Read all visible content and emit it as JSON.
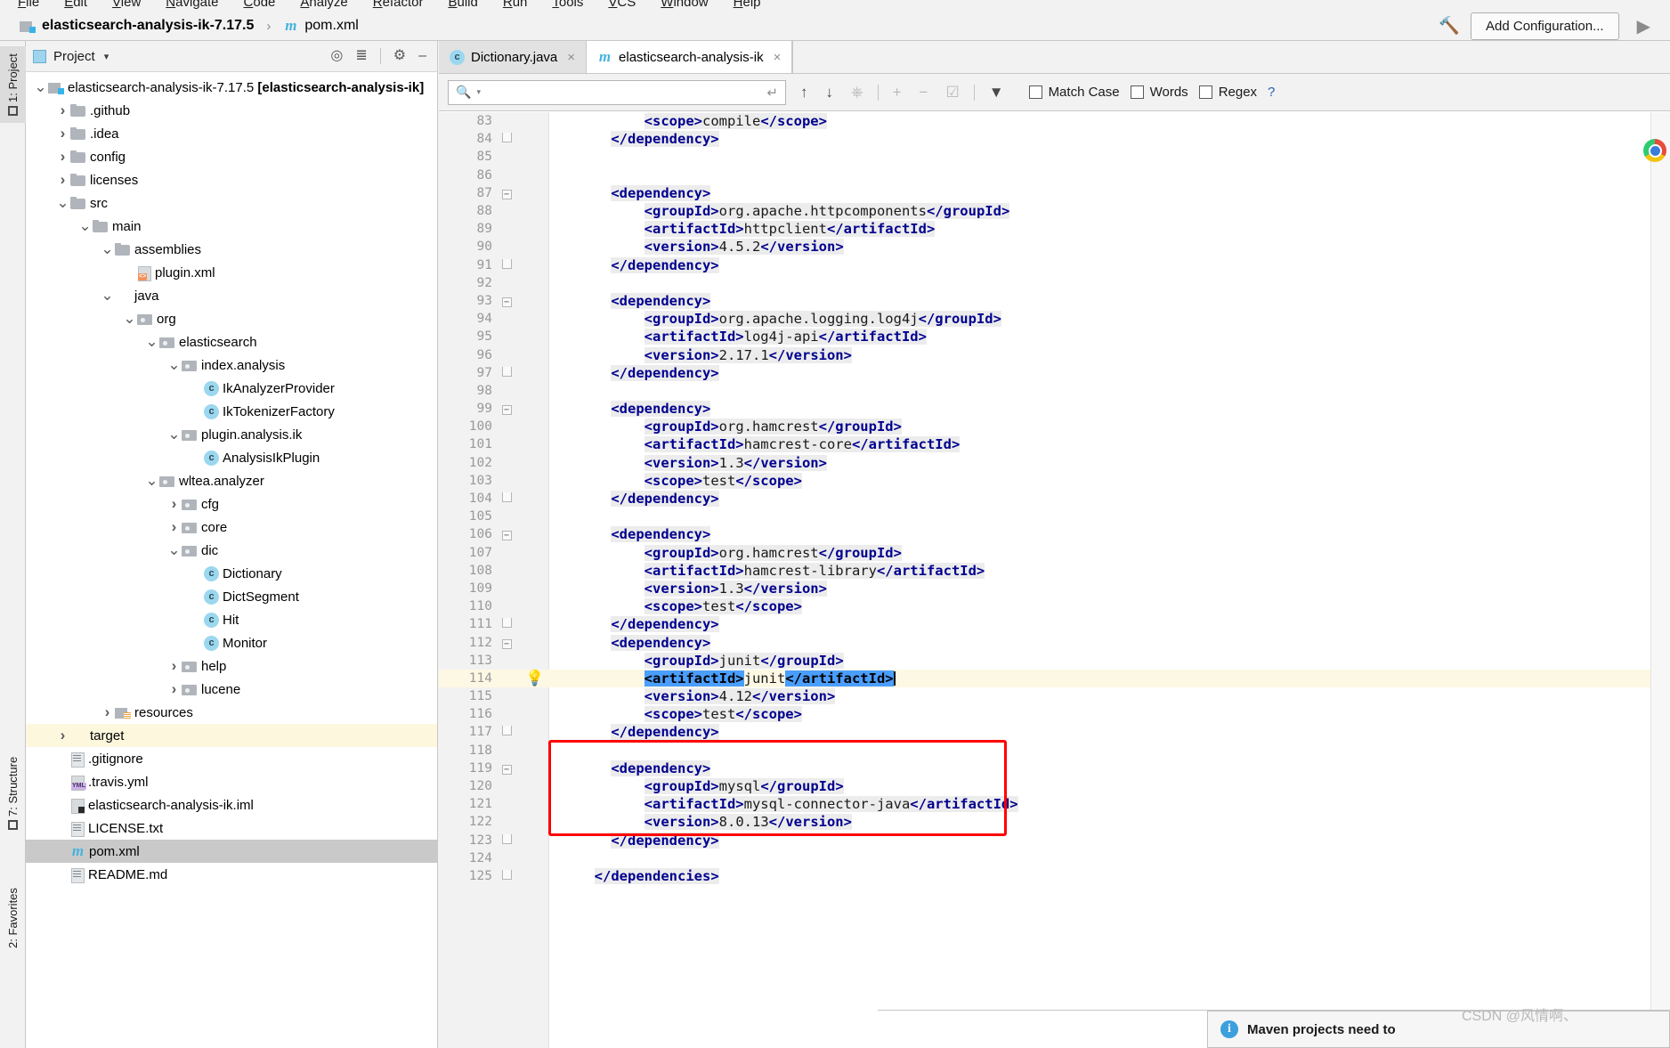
{
  "menu": {
    "items": [
      "File",
      "Edit",
      "View",
      "Navigate",
      "Code",
      "Analyze",
      "Refactor",
      "Build",
      "Run",
      "Tools",
      "VCS",
      "Window",
      "Help"
    ]
  },
  "navbar": {
    "project_name": "elasticsearch-analysis-ik-7.17.5",
    "separator": "›",
    "file_name": "pom.xml",
    "maven_glyph": "m",
    "add_configuration_label": "Add Configuration...",
    "run_icon": "run-play-icon",
    "hammer_icon": "build-hammer-icon"
  },
  "left_tool_strip": {
    "tabs": [
      "1: Project",
      "7: Structure",
      "2: Favorites"
    ]
  },
  "project_panel": {
    "title": "Project",
    "caret": "▾",
    "toolbar_icons": [
      "locate-target-icon",
      "collapse-all-icon",
      "gear-icon",
      "hide-icon"
    ],
    "tree": [
      {
        "depth": 0,
        "arrow": "down",
        "icon": "srcmark",
        "label": "elasticsearch-analysis-ik-7.17.5 ",
        "bold": "[elasticsearch-analysis-ik]",
        "state": "normal"
      },
      {
        "depth": 1,
        "arrow": "right",
        "icon": "folder",
        "label": ".github",
        "state": "normal"
      },
      {
        "depth": 1,
        "arrow": "right",
        "icon": "folder",
        "label": ".idea",
        "state": "normal"
      },
      {
        "depth": 1,
        "arrow": "right",
        "icon": "folder",
        "label": "config",
        "state": "normal"
      },
      {
        "depth": 1,
        "arrow": "right",
        "icon": "folder",
        "label": "licenses",
        "state": "normal"
      },
      {
        "depth": 1,
        "arrow": "down",
        "icon": "folder",
        "label": "src",
        "state": "normal"
      },
      {
        "depth": 2,
        "arrow": "down",
        "icon": "folder",
        "label": "main",
        "state": "normal"
      },
      {
        "depth": 3,
        "arrow": "down",
        "icon": "folder",
        "label": "assemblies",
        "state": "normal"
      },
      {
        "depth": 4,
        "arrow": "none",
        "icon": "xml",
        "label": "plugin.xml",
        "state": "normal"
      },
      {
        "depth": 3,
        "arrow": "down",
        "icon": "folder-blue",
        "label": "java",
        "state": "normal"
      },
      {
        "depth": 4,
        "arrow": "down",
        "icon": "pkg",
        "label": "org",
        "state": "normal"
      },
      {
        "depth": 5,
        "arrow": "down",
        "icon": "pkg",
        "label": "elasticsearch",
        "state": "normal"
      },
      {
        "depth": 6,
        "arrow": "down",
        "icon": "pkg",
        "label": "index.analysis",
        "state": "normal"
      },
      {
        "depth": 7,
        "arrow": "none",
        "icon": "class",
        "label": "IkAnalyzerProvider",
        "state": "normal"
      },
      {
        "depth": 7,
        "arrow": "none",
        "icon": "class",
        "label": "IkTokenizerFactory",
        "state": "normal"
      },
      {
        "depth": 6,
        "arrow": "down",
        "icon": "pkg",
        "label": "plugin.analysis.ik",
        "state": "normal"
      },
      {
        "depth": 7,
        "arrow": "none",
        "icon": "class",
        "label": "AnalysisIkPlugin",
        "state": "normal"
      },
      {
        "depth": 5,
        "arrow": "down",
        "icon": "pkg",
        "label": "wltea.analyzer",
        "state": "normal"
      },
      {
        "depth": 6,
        "arrow": "right",
        "icon": "pkg",
        "label": "cfg",
        "state": "normal"
      },
      {
        "depth": 6,
        "arrow": "right",
        "icon": "pkg",
        "label": "core",
        "state": "normal"
      },
      {
        "depth": 6,
        "arrow": "down",
        "icon": "pkg",
        "label": "dic",
        "state": "normal"
      },
      {
        "depth": 7,
        "arrow": "none",
        "icon": "class",
        "label": "Dictionary",
        "state": "normal"
      },
      {
        "depth": 7,
        "arrow": "none",
        "icon": "class",
        "label": "DictSegment",
        "state": "normal"
      },
      {
        "depth": 7,
        "arrow": "none",
        "icon": "class",
        "label": "Hit",
        "state": "normal"
      },
      {
        "depth": 7,
        "arrow": "none",
        "icon": "class",
        "label": "Monitor",
        "state": "normal"
      },
      {
        "depth": 6,
        "arrow": "right",
        "icon": "pkg",
        "label": "help",
        "state": "normal"
      },
      {
        "depth": 6,
        "arrow": "right",
        "icon": "pkg",
        "label": "lucene",
        "state": "normal"
      },
      {
        "depth": 3,
        "arrow": "right",
        "icon": "resmark",
        "label": "resources",
        "state": "normal"
      },
      {
        "depth": 1,
        "arrow": "right",
        "icon": "folder-orange",
        "label": "target",
        "state": "highlight"
      },
      {
        "depth": 1,
        "arrow": "none",
        "icon": "txt",
        "label": ".gitignore",
        "state": "normal"
      },
      {
        "depth": 1,
        "arrow": "none",
        "icon": "yml",
        "label": ".travis.yml",
        "state": "normal"
      },
      {
        "depth": 1,
        "arrow": "none",
        "icon": "iml",
        "label": "elasticsearch-analysis-ik.iml",
        "state": "normal"
      },
      {
        "depth": 1,
        "arrow": "none",
        "icon": "txt",
        "label": "LICENSE.txt",
        "state": "normal"
      },
      {
        "depth": 1,
        "arrow": "none",
        "icon": "maven",
        "label": "pom.xml",
        "state": "selected"
      },
      {
        "depth": 1,
        "arrow": "none",
        "icon": "txt",
        "label": "README.md",
        "state": "normal"
      }
    ]
  },
  "editor": {
    "tabs": [
      {
        "label": "Dictionary.java",
        "icon": "class",
        "active": false,
        "close": "×"
      },
      {
        "label": "elasticsearch-analysis-ik",
        "icon": "maven",
        "active": true,
        "close": "×"
      }
    ],
    "find_bar": {
      "search_value": "",
      "search_placeholder": "",
      "search_icon": "search-magnifier-icon",
      "dropdown_caret": "▾",
      "return_icon": "↵",
      "buttons": [
        "find-prev-up-icon",
        "find-next-down-icon",
        "select-all-occurrences-icon",
        "add-line-icon",
        "remove-line-icon",
        "check-lines-icon",
        "filter-icon"
      ],
      "match_case_label": "Match Case",
      "words_label": "Words",
      "regex_label": "Regex",
      "help_label": "?"
    },
    "first_line_number": 83,
    "current_line": 114,
    "lines": [
      {
        "n": 83,
        "fold": "",
        "indent": 8,
        "tokens": [
          {
            "t": "<scope>",
            "k": "tg",
            "hl": true
          },
          {
            "t": "compile",
            "k": "txt",
            "hl": true
          },
          {
            "t": "</scope>",
            "k": "tg",
            "hl": true
          }
        ]
      },
      {
        "n": 84,
        "fold": "cap",
        "indent": 4,
        "tokens": [
          {
            "t": "</dependency>",
            "k": "tg",
            "hl": true
          }
        ]
      },
      {
        "n": 85,
        "fold": "",
        "indent": 0,
        "tokens": []
      },
      {
        "n": 86,
        "fold": "",
        "indent": 0,
        "tokens": []
      },
      {
        "n": 87,
        "fold": "minus",
        "indent": 4,
        "tokens": [
          {
            "t": "<dependency>",
            "k": "tg",
            "hl": true
          }
        ]
      },
      {
        "n": 88,
        "fold": "",
        "indent": 8,
        "tokens": [
          {
            "t": "<groupId>",
            "k": "tg",
            "hl": true
          },
          {
            "t": "org.apache.httpcomponents",
            "k": "txt",
            "hl": true
          },
          {
            "t": "</groupId>",
            "k": "tg",
            "hl": true
          }
        ]
      },
      {
        "n": 89,
        "fold": "",
        "indent": 8,
        "tokens": [
          {
            "t": "<artifactId>",
            "k": "tg",
            "hl": true
          },
          {
            "t": "httpclient",
            "k": "txt",
            "hl": true
          },
          {
            "t": "</artifactId>",
            "k": "tg",
            "hl": true
          }
        ]
      },
      {
        "n": 90,
        "fold": "",
        "indent": 8,
        "tokens": [
          {
            "t": "<version>",
            "k": "tg",
            "hl": true
          },
          {
            "t": "4.5.2",
            "k": "txt",
            "hl": true
          },
          {
            "t": "</version>",
            "k": "tg",
            "hl": true
          }
        ]
      },
      {
        "n": 91,
        "fold": "cap",
        "indent": 4,
        "tokens": [
          {
            "t": "</dependency>",
            "k": "tg",
            "hl": true
          }
        ]
      },
      {
        "n": 92,
        "fold": "",
        "indent": 0,
        "tokens": []
      },
      {
        "n": 93,
        "fold": "minus",
        "indent": 4,
        "tokens": [
          {
            "t": "<dependency>",
            "k": "tg",
            "hl": true
          }
        ]
      },
      {
        "n": 94,
        "fold": "",
        "indent": 8,
        "tokens": [
          {
            "t": "<groupId>",
            "k": "tg",
            "hl": true
          },
          {
            "t": "org.apache.logging.log4j",
            "k": "txt",
            "hl": true
          },
          {
            "t": "</groupId>",
            "k": "tg",
            "hl": true
          }
        ]
      },
      {
        "n": 95,
        "fold": "",
        "indent": 8,
        "tokens": [
          {
            "t": "<artifactId>",
            "k": "tg",
            "hl": true
          },
          {
            "t": "log4j-api",
            "k": "txt",
            "hl": true
          },
          {
            "t": "</artifactId>",
            "k": "tg",
            "hl": true
          }
        ]
      },
      {
        "n": 96,
        "fold": "",
        "indent": 8,
        "tokens": [
          {
            "t": "<version>",
            "k": "tg",
            "hl": true
          },
          {
            "t": "2.17.1",
            "k": "txt",
            "hl": true
          },
          {
            "t": "</version>",
            "k": "tg",
            "hl": true
          }
        ]
      },
      {
        "n": 97,
        "fold": "cap",
        "indent": 4,
        "tokens": [
          {
            "t": "</dependency>",
            "k": "tg",
            "hl": true
          }
        ]
      },
      {
        "n": 98,
        "fold": "",
        "indent": 0,
        "tokens": []
      },
      {
        "n": 99,
        "fold": "minus",
        "indent": 4,
        "tokens": [
          {
            "t": "<dependency>",
            "k": "tg",
            "hl": true
          }
        ]
      },
      {
        "n": 100,
        "fold": "",
        "indent": 8,
        "tokens": [
          {
            "t": "<groupId>",
            "k": "tg",
            "hl": true
          },
          {
            "t": "org.hamcrest",
            "k": "txt",
            "hl": true
          },
          {
            "t": "</groupId>",
            "k": "tg",
            "hl": true
          }
        ]
      },
      {
        "n": 101,
        "fold": "",
        "indent": 8,
        "tokens": [
          {
            "t": "<artifactId>",
            "k": "tg",
            "hl": true
          },
          {
            "t": "hamcrest-core",
            "k": "txt",
            "hl": true
          },
          {
            "t": "</artifactId>",
            "k": "tg",
            "hl": true
          }
        ]
      },
      {
        "n": 102,
        "fold": "",
        "indent": 8,
        "tokens": [
          {
            "t": "<version>",
            "k": "tg",
            "hl": true
          },
          {
            "t": "1.3",
            "k": "txt",
            "hl": true
          },
          {
            "t": "</version>",
            "k": "tg",
            "hl": true
          }
        ]
      },
      {
        "n": 103,
        "fold": "",
        "indent": 8,
        "tokens": [
          {
            "t": "<scope>",
            "k": "tg",
            "hl": true
          },
          {
            "t": "test",
            "k": "txt",
            "hl": true
          },
          {
            "t": "</scope>",
            "k": "tg",
            "hl": true
          }
        ]
      },
      {
        "n": 104,
        "fold": "cap",
        "indent": 4,
        "tokens": [
          {
            "t": "</dependency>",
            "k": "tg",
            "hl": true
          }
        ]
      },
      {
        "n": 105,
        "fold": "",
        "indent": 0,
        "tokens": []
      },
      {
        "n": 106,
        "fold": "minus",
        "indent": 4,
        "tokens": [
          {
            "t": "<dependency>",
            "k": "tg",
            "hl": true
          }
        ]
      },
      {
        "n": 107,
        "fold": "",
        "indent": 8,
        "tokens": [
          {
            "t": "<groupId>",
            "k": "tg",
            "hl": true
          },
          {
            "t": "org.hamcrest",
            "k": "txt",
            "hl": true
          },
          {
            "t": "</groupId>",
            "k": "tg",
            "hl": true
          }
        ]
      },
      {
        "n": 108,
        "fold": "",
        "indent": 8,
        "tokens": [
          {
            "t": "<artifactId>",
            "k": "tg",
            "hl": true
          },
          {
            "t": "hamcrest-library",
            "k": "txt",
            "hl": true
          },
          {
            "t": "</artifactId>",
            "k": "tg",
            "hl": true
          }
        ]
      },
      {
        "n": 109,
        "fold": "",
        "indent": 8,
        "tokens": [
          {
            "t": "<version>",
            "k": "tg",
            "hl": true
          },
          {
            "t": "1.3",
            "k": "txt",
            "hl": true
          },
          {
            "t": "</version>",
            "k": "tg",
            "hl": true
          }
        ]
      },
      {
        "n": 110,
        "fold": "",
        "indent": 8,
        "tokens": [
          {
            "t": "<scope>",
            "k": "tg",
            "hl": true
          },
          {
            "t": "test",
            "k": "txt",
            "hl": true
          },
          {
            "t": "</scope>",
            "k": "tg",
            "hl": true
          }
        ]
      },
      {
        "n": 111,
        "fold": "cap",
        "indent": 4,
        "tokens": [
          {
            "t": "</dependency>",
            "k": "tg",
            "hl": true
          }
        ]
      },
      {
        "n": 112,
        "fold": "minus",
        "indent": 4,
        "tokens": [
          {
            "t": "<dependency>",
            "k": "tg",
            "hl": true
          }
        ]
      },
      {
        "n": 113,
        "fold": "",
        "indent": 8,
        "tokens": [
          {
            "t": "<groupId>",
            "k": "tg",
            "hl": true
          },
          {
            "t": "junit",
            "k": "txt",
            "hl": true
          },
          {
            "t": "</groupId>",
            "k": "tg",
            "hl": true
          }
        ]
      },
      {
        "n": 114,
        "fold": "",
        "indent": 8,
        "bulb": true,
        "current": true,
        "tokens": [
          {
            "t": "<artifactId>",
            "k": "tg",
            "sel": true
          },
          {
            "t": "junit",
            "k": "txt"
          },
          {
            "t": "</artifactId>",
            "k": "tg",
            "sel": true
          },
          {
            "t": "",
            "k": "caret"
          }
        ]
      },
      {
        "n": 115,
        "fold": "",
        "indent": 8,
        "tokens": [
          {
            "t": "<version>",
            "k": "tg",
            "hl": true
          },
          {
            "t": "4.12",
            "k": "txt",
            "hl": true
          },
          {
            "t": "</version>",
            "k": "tg",
            "hl": true
          }
        ]
      },
      {
        "n": 116,
        "fold": "",
        "indent": 8,
        "tokens": [
          {
            "t": "<scope>",
            "k": "tg",
            "hl": true
          },
          {
            "t": "test",
            "k": "txt",
            "hl": true
          },
          {
            "t": "</scope>",
            "k": "tg",
            "hl": true
          }
        ]
      },
      {
        "n": 117,
        "fold": "cap",
        "indent": 4,
        "tokens": [
          {
            "t": "</dependency>",
            "k": "tg",
            "hl": true
          }
        ]
      },
      {
        "n": 118,
        "fold": "",
        "indent": 0,
        "tokens": []
      },
      {
        "n": 119,
        "fold": "minus",
        "indent": 4,
        "tokens": [
          {
            "t": "<dependency>",
            "k": "tg",
            "hl": true
          }
        ]
      },
      {
        "n": 120,
        "fold": "",
        "indent": 8,
        "tokens": [
          {
            "t": "<groupId>",
            "k": "tg",
            "hl": true
          },
          {
            "t": "mysql",
            "k": "txt",
            "hl": true
          },
          {
            "t": "</groupId>",
            "k": "tg",
            "hl": true
          }
        ]
      },
      {
        "n": 121,
        "fold": "",
        "indent": 8,
        "tokens": [
          {
            "t": "<artifactId>",
            "k": "tg",
            "hl": true
          },
          {
            "t": "mysql-connector-java",
            "k": "txt",
            "hl": true
          },
          {
            "t": "</artifactId>",
            "k": "tg",
            "hl": true
          }
        ]
      },
      {
        "n": 122,
        "fold": "",
        "indent": 8,
        "tokens": [
          {
            "t": "<version>",
            "k": "tg",
            "hl": true
          },
          {
            "t": "8.0.13",
            "k": "txt",
            "hl": true
          },
          {
            "t": "</version>",
            "k": "tg",
            "hl": true
          }
        ]
      },
      {
        "n": 123,
        "fold": "cap",
        "indent": 4,
        "tokens": [
          {
            "t": "</dependency>",
            "k": "tg",
            "hl": true
          }
        ]
      },
      {
        "n": 124,
        "fold": "",
        "indent": 0,
        "tokens": []
      },
      {
        "n": 125,
        "fold": "cap",
        "indent": 2,
        "tokens": [
          {
            "t": "</dependencies>",
            "k": "tg",
            "hl": true
          }
        ]
      }
    ]
  },
  "annotation": {
    "red_box_label": "mysql-dependency-highlight-box",
    "red_box_color": "#ff0000"
  },
  "notification": {
    "icon": "info-icon",
    "text": "Maven projects need to"
  },
  "watermark": {
    "text": "CSDN @风情啊、"
  }
}
